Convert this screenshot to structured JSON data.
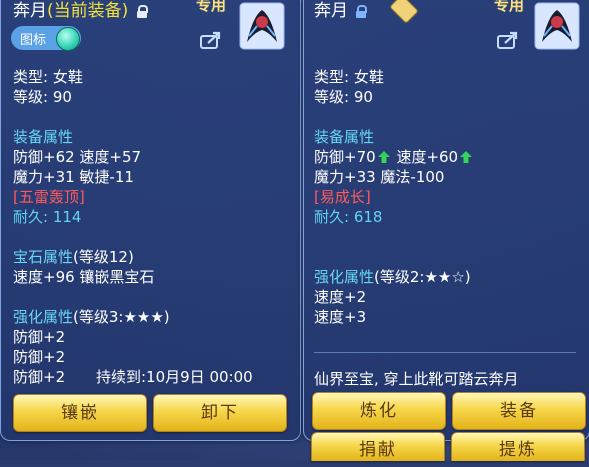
{
  "left": {
    "title": "奔月",
    "title_tag": "(当前装备)",
    "exclusive": "专用",
    "toggle_label": "图标",
    "type_line": "类型: 女鞋",
    "level_line": "等级: 90",
    "equip_attr_header": "装备属性",
    "attr_line1": "防御+62 速度+57",
    "attr_line2": "魔力+31 敏捷-11",
    "special_skill": "[五雷轰顶]",
    "durability": "耐久: 114",
    "gem_header": "宝石属性",
    "gem_level": "(等级12)",
    "gem_line": "速度+96 镶嵌黑宝石",
    "enhance_header": "强化属性",
    "enhance_level": "(等级3:★★★)",
    "enhance_lines": [
      "防御+2",
      "防御+2",
      "防御+2"
    ],
    "duration_text": "持续到:10月9日 00:00",
    "buttons": {
      "inlay": "镶嵌",
      "remove": "卸下"
    }
  },
  "right": {
    "title": "奔月",
    "exclusive": "专用",
    "type_line": "类型: 女鞋",
    "level_line": "等级: 90",
    "equip_attr_header": "装备属性",
    "def_text": "防御+70",
    "spd_text": "速度+60",
    "attr_line2": "魔力+33 魔法-100",
    "special_skill": "[易成长]",
    "durability": "耐久: 618",
    "enhance_header": "强化属性",
    "enhance_level": "(等级2:★★☆)",
    "enhance_lines": [
      "速度+2",
      "速度+3"
    ],
    "description": "仙界至宝, 穿上此靴可踏云奔月",
    "buttons": {
      "refine": "炼化",
      "equip": "装备",
      "donate": "捐献",
      "extract": "提炼"
    }
  },
  "colors": {
    "panel_border": "#7fa2e0",
    "section_header": "#68d6f5",
    "highlight_yellow": "#f2e23a",
    "skill_red": "#ff5a5a",
    "durability_cyan": "#5fd5f3",
    "arrow_green": "#35d35a",
    "button_gold": "#f6d64a"
  },
  "icons": [
    "lock-icon",
    "share-icon",
    "portrait-icon",
    "toggle-switch",
    "up-arrow-icon",
    "jade-badge-icon"
  ]
}
